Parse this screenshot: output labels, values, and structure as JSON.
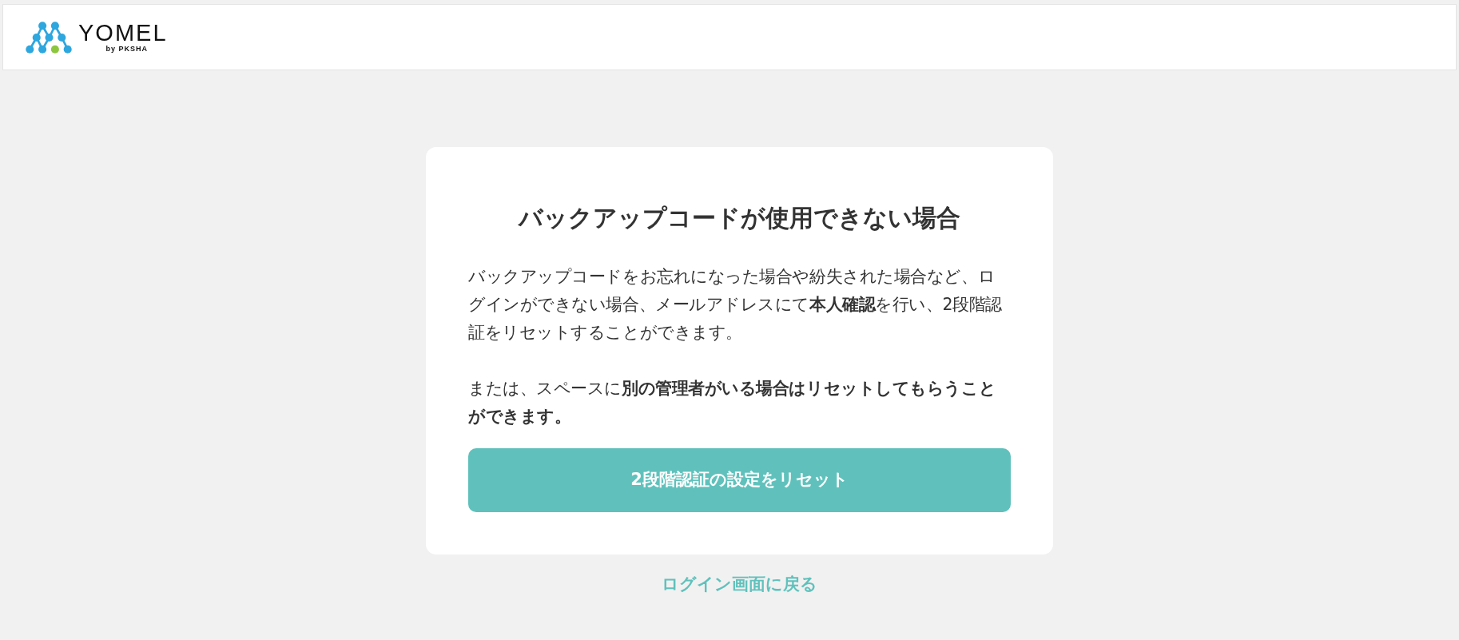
{
  "header": {
    "logo": {
      "wordmark": "YOMEL",
      "byline": "by PKSHA"
    }
  },
  "card": {
    "title": "バックアップコードが使用できない場合",
    "paragraphs": [
      "バックアップコードをお忘れになった場合や紛失された場合など、ログインができない場合、メールアドレスにて**本人確認**を行い、2段階認証をリセットすることができます。",
      "または、スペースに**別の管理者がいる場合はリセットしてもらうことができます。**"
    ],
    "button": "2段階認証の設定をリセット"
  },
  "back_link": "ログイン画面に戻る"
}
